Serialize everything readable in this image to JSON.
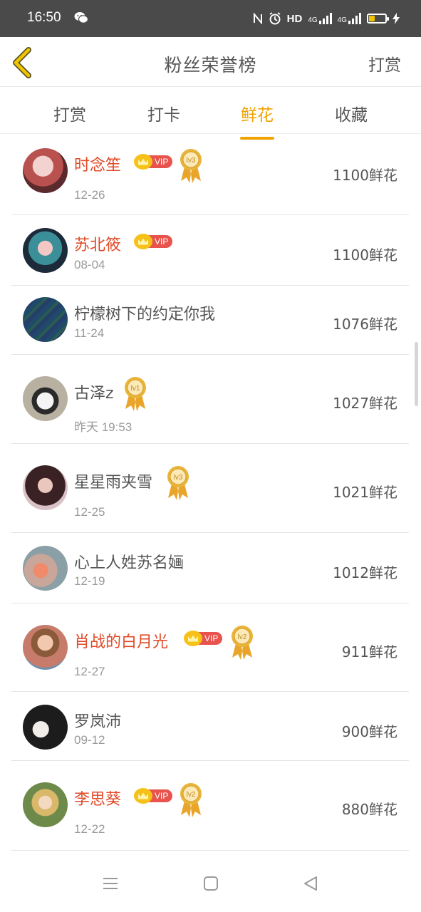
{
  "status_bar": {
    "time": "16:50",
    "hd_label": "HD",
    "net1": "4G",
    "net2": "4G"
  },
  "header": {
    "title": "粉丝荣誉榜",
    "action_label": "打赏"
  },
  "tabs": [
    {
      "label": "打赏",
      "active": false
    },
    {
      "label": "打卡",
      "active": false
    },
    {
      "label": "鲜花",
      "active": true
    },
    {
      "label": "收藏",
      "active": false
    }
  ],
  "fans": [
    {
      "name": "时念笙",
      "vip": true,
      "vip_label": "VIP",
      "level": "lv3",
      "date": "12-26",
      "amount": "1100鲜花"
    },
    {
      "name": "苏北筱",
      "vip": true,
      "vip_label": "VIP",
      "level": "",
      "date": "08-04",
      "amount": "1100鲜花"
    },
    {
      "name": "柠檬树下的约定你我",
      "vip": false,
      "vip_label": "",
      "level": "",
      "date": "11-24",
      "amount": "1076鲜花"
    },
    {
      "name": "古泽z",
      "vip": false,
      "vip_label": "",
      "level": "lv1",
      "date": "昨天 19:53",
      "amount": "1027鲜花"
    },
    {
      "name": "星星雨夹雪",
      "vip": false,
      "vip_label": "",
      "level": "lv3",
      "date": "12-25",
      "amount": "1021鲜花"
    },
    {
      "name": "心上人姓苏名婳",
      "vip": false,
      "vip_label": "",
      "level": "",
      "date": "12-19",
      "amount": "1012鲜花"
    },
    {
      "name": "肖战的白月光",
      "vip": true,
      "vip_label": "VIP",
      "level": "lv2",
      "date": "12-27",
      "amount": "911鲜花"
    },
    {
      "name": "罗岚沛",
      "vip": false,
      "vip_label": "",
      "level": "",
      "date": "09-12",
      "amount": "900鲜花"
    },
    {
      "name": "李思葵",
      "vip": true,
      "vip_label": "VIP",
      "level": "lv2",
      "date": "12-22",
      "amount": "880鲜花"
    }
  ],
  "colors": {
    "accent": "#f0a200",
    "vip_name": "#e04a28",
    "vip_tag": "#e8534d",
    "medal_gold": "#e8b53a"
  }
}
